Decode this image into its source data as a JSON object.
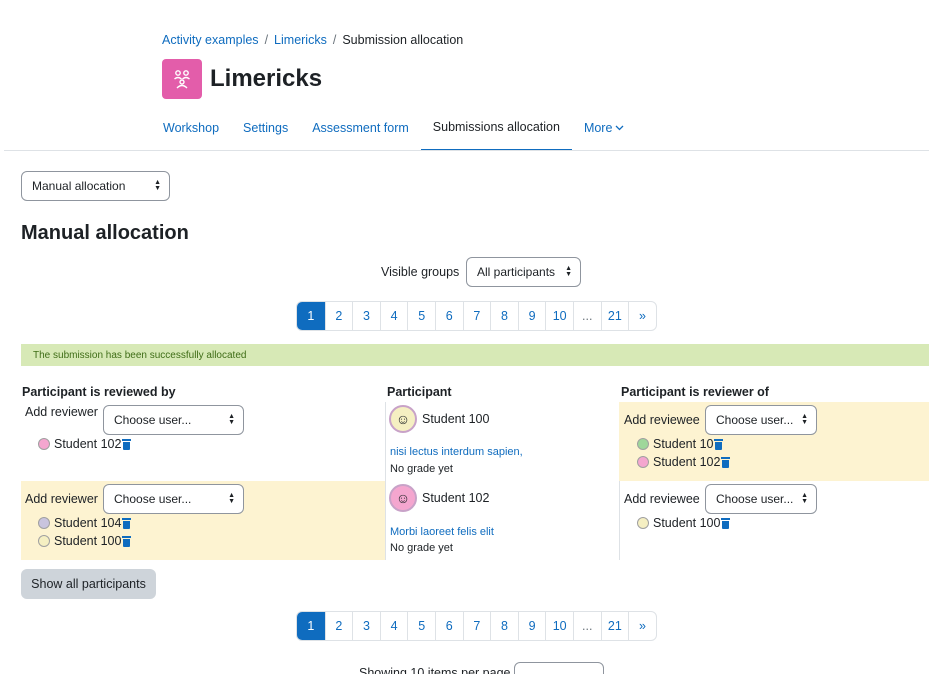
{
  "breadcrumb": {
    "items": [
      "Activity examples",
      "Limericks"
    ],
    "current": "Submission allocation"
  },
  "page": {
    "title": "Limericks"
  },
  "tabs": [
    {
      "label": "Workshop"
    },
    {
      "label": "Settings"
    },
    {
      "label": "Assessment form"
    },
    {
      "label": "Submissions allocation",
      "active": true
    },
    {
      "label": "More"
    }
  ],
  "allocation_method": {
    "value": "Manual allocation"
  },
  "heading": "Manual allocation",
  "visible_groups": {
    "label": "Visible groups",
    "value": "All participants"
  },
  "pagination": {
    "pages": [
      "1",
      "2",
      "3",
      "4",
      "5",
      "6",
      "7",
      "8",
      "9",
      "10",
      "...",
      "21",
      "»"
    ],
    "current": "1"
  },
  "alert": "The submission has been successfully allocated",
  "table": {
    "headers": {
      "reviewed_by": "Participant is reviewed by",
      "participant": "Participant",
      "reviewer_of": "Participant is reviewer of"
    },
    "add_reviewer_label": "Add reviewer",
    "add_reviewee_label": "Add reviewee",
    "choose_user": "Choose user...",
    "rows": [
      {
        "reviewed_by": [
          "Student 102"
        ],
        "participant": {
          "name": "Student 100",
          "submission": "nisi lectus interdum sapien,",
          "grade": "No grade yet"
        },
        "reviewer_of": [
          "Student 10",
          "Student 102"
        ]
      },
      {
        "reviewed_by": [
          "Student 104",
          "Student 100"
        ],
        "participant": {
          "name": "Student 102",
          "submission": "Morbi laoreet felis elit",
          "grade": "No grade yet"
        },
        "reviewer_of": [
          "Student 100"
        ]
      }
    ]
  },
  "show_all_button": "Show all participants",
  "footer": {
    "showing_text": "Showing 10 items per page"
  },
  "colors": {
    "primary": "#0f6cbf",
    "activity_icon": "#e35daa",
    "highlight": "#fdf3d1",
    "alert_bg": "#d7e9b6"
  }
}
